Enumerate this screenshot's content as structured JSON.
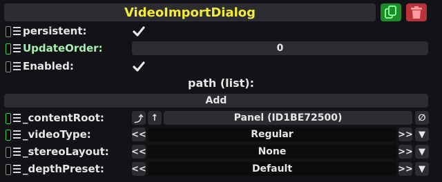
{
  "header": {
    "title": "VideoImportDialog"
  },
  "fields": {
    "persistent": {
      "label": "persistent:",
      "checked": true
    },
    "update_order": {
      "label": "UpdateOrder:",
      "value": "0"
    },
    "enabled": {
      "label": "Enabled:",
      "checked": true
    }
  },
  "path": {
    "title": "path (list):",
    "add_label": "Add"
  },
  "content_root": {
    "label": "_contentRoot:",
    "value": "Panel (ID1BE72500)"
  },
  "video_type": {
    "label": "_videoType:",
    "value": "Regular"
  },
  "stereo_layout": {
    "label": "_stereoLayout:",
    "value": "None"
  },
  "depth_preset": {
    "label": "_depthPreset:",
    "value": "Default"
  },
  "controls": {
    "prev": "<<",
    "next": ">>",
    "dropdown": "▼",
    "clear": "∅",
    "jump_up": "⤴",
    "up": "↑"
  },
  "colors": {
    "title": "#f4eb3a",
    "duplicate_button": "#1e8a2a",
    "delete_button": "#b8333a",
    "driven_label": "#a6efb0",
    "handle_green": "#3cd05a"
  }
}
